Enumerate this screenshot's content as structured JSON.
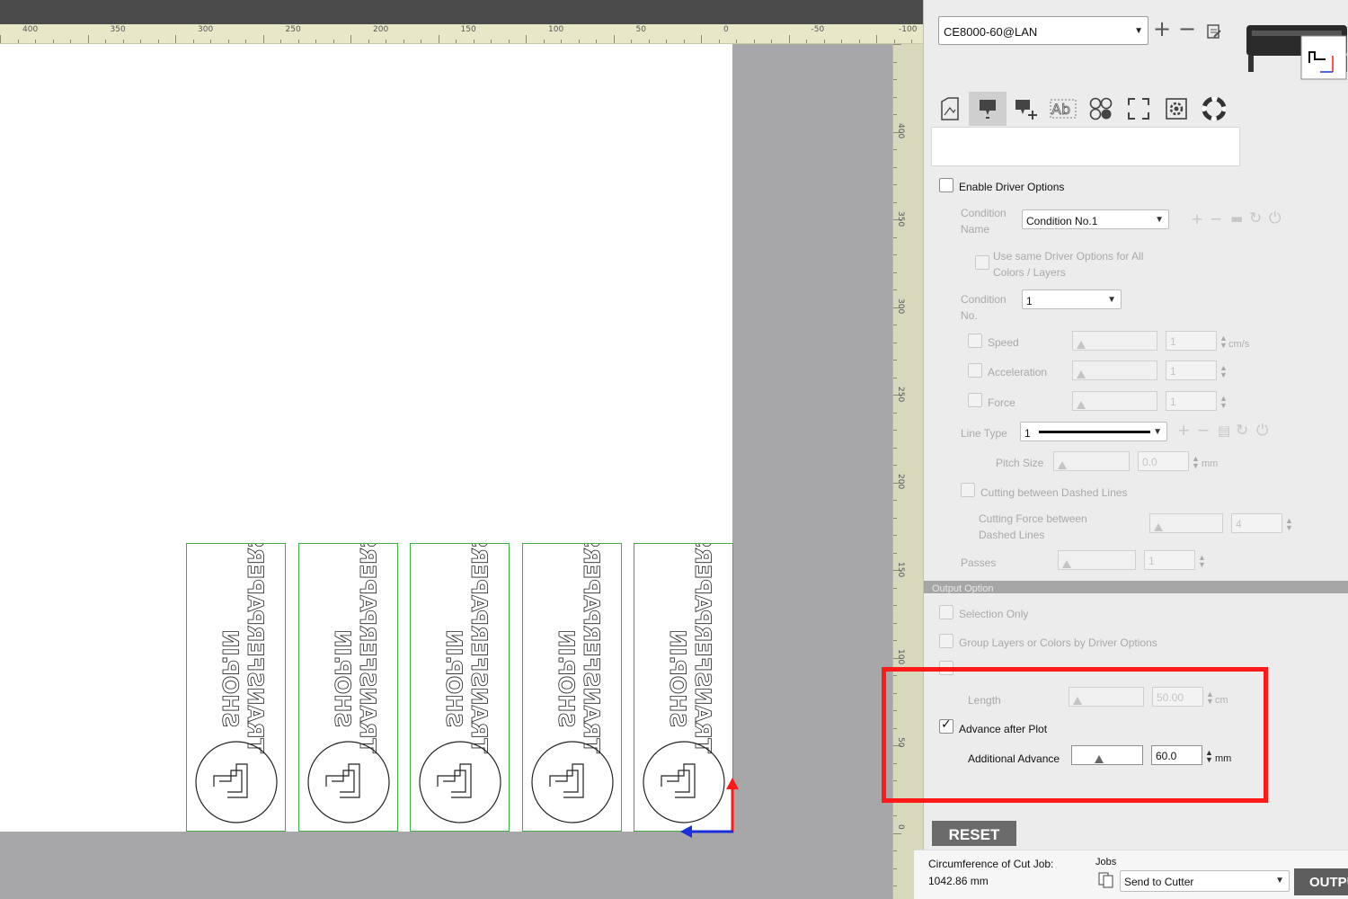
{
  "ruler": {
    "horizontal_labels": [
      "400",
      "350",
      "300",
      "250",
      "200",
      "150",
      "100",
      "50",
      "0",
      "-50",
      "-100"
    ],
    "vertical_labels": [
      "400",
      "350",
      "300",
      "250",
      "200",
      "150",
      "100",
      "50",
      "0"
    ]
  },
  "canvas": {
    "label_text_line1": "TRANSFERPAPERS",
    "label_text_line2": "SHOP.IN",
    "label_count": 5,
    "colors": {
      "paper": "#ffffff",
      "workspace": "#a7a7aa",
      "outline": "#3cb043",
      "x_axis": "#1a2fd8",
      "y_axis": "#ff1a1a"
    }
  },
  "device": {
    "selected": "CE8000-60@LAN",
    "add_icon": "plus-icon",
    "remove_icon": "minus-icon",
    "edit_icon": "edit-icon",
    "machine_icon": "plotter-icon"
  },
  "tabs": [
    {
      "icon": "document-icon",
      "active": false
    },
    {
      "icon": "cutter-condition-icon",
      "active": true
    },
    {
      "icon": "cutter-add-icon",
      "active": false
    },
    {
      "icon": "text-ab-icon",
      "active": false
    },
    {
      "icon": "registration-marks-icon",
      "active": false
    },
    {
      "icon": "crop-frame-icon",
      "active": false
    },
    {
      "icon": "settings-icon",
      "active": false
    },
    {
      "icon": "help-lifebuoy-icon",
      "active": false
    }
  ],
  "driver": {
    "enable_label": "Enable Driver Options",
    "condition_name_label": "Condition Name",
    "condition_name_value": "Condition No.1",
    "use_same_label": "Use same Driver Options for All Colors / Layers",
    "condition_no_label": "Condition No.",
    "condition_no_value": "1",
    "speed_label": "Speed",
    "speed_value": "1",
    "speed_unit": "cm/s",
    "acceleration_label": "Acceleration",
    "acceleration_value": "1",
    "force_label": "Force",
    "force_value": "1",
    "line_type_label": "Line Type",
    "line_type_value": "1",
    "pitch_label": "Pitch Size",
    "pitch_value": "0.0",
    "pitch_unit": "mm",
    "cut_between_label": "Cutting between Dashed Lines",
    "cut_force_label": "Cutting Force between Dashed Lines",
    "cut_force_value": "4",
    "passes_label": "Passes",
    "passes_value": "1"
  },
  "output": {
    "section_label": "Output Option",
    "selection_only_label": "Selection Only",
    "group_layers_label": "Group Layers or Colors by Driver Options",
    "length_label": "Length",
    "length_value": "50.00",
    "length_unit": "cm",
    "advance_label": "Advance after Plot",
    "advance_checked": true,
    "additional_label": "Additional Advance",
    "additional_value": "60.0",
    "additional_unit": "mm"
  },
  "footer": {
    "reset_label": "RESET",
    "circumference_label": "Circumference of Cut Job:",
    "circumference_value": "1042.86 mm",
    "jobs_label": "Jobs",
    "jobs_icon": "copy-pages-icon",
    "send_value": "Send to Cutter",
    "output_label": "OUTPU"
  }
}
